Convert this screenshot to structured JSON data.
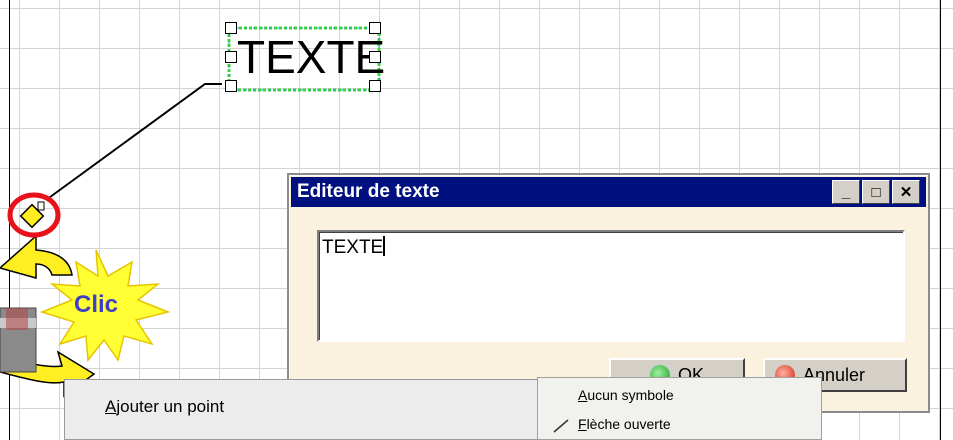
{
  "canvas": {
    "text_entity": "TEXTE"
  },
  "callout": {
    "label": "Clic"
  },
  "dialog": {
    "title": "Editeur de texte",
    "window_buttons": {
      "minimize": "_",
      "maximize": "□",
      "close": "✕"
    },
    "editor_value": "TEXTE",
    "ok_label": "OK",
    "cancel_label": "Annuler"
  },
  "context_menu": {
    "item": {
      "prefix": "",
      "accel": "A",
      "rest": "jouter un point"
    }
  },
  "submenu": {
    "items": [
      {
        "accel": "A",
        "rest": "ucun symbole"
      },
      {
        "accel": "F",
        "rest": "lèche ouverte"
      }
    ]
  },
  "colors": {
    "titlebar": "#00107f",
    "dialog_bg": "#fbf1df",
    "highlight_circle": "#e8101a",
    "starburst": "#ffff33",
    "selection_dots": "#3fd43f",
    "clic_text": "#3e3ec6",
    "anchor_yellow": "#ffee22"
  },
  "icons": [
    "ok-icon",
    "cancel-icon",
    "anchor-handle-icon",
    "starburst-icon",
    "curved-arrow-icon"
  ]
}
